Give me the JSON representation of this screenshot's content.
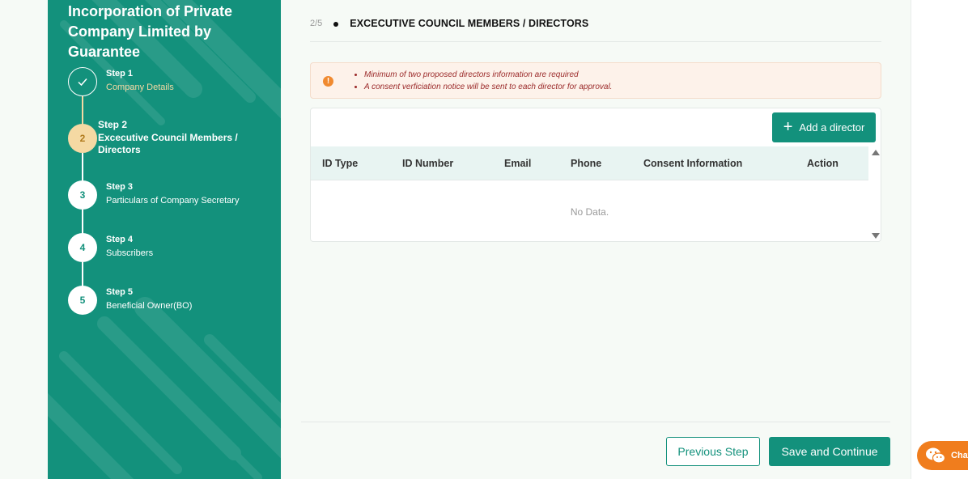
{
  "sidebar": {
    "title": "Incorporation of Private Company Limited by Guarantee",
    "steps": [
      {
        "title": "Step 1",
        "subtitle": "Company Details",
        "number": "",
        "state": "done"
      },
      {
        "title": "Step 2",
        "subtitle": "Excecutive Council Members / Directors",
        "number": "2",
        "state": "active"
      },
      {
        "title": "Step 3",
        "subtitle": "Particulars of Company Secretary",
        "number": "3",
        "state": "pending"
      },
      {
        "title": "Step 4",
        "subtitle": "Subscribers",
        "number": "4",
        "state": "pending"
      },
      {
        "title": "Step 5",
        "subtitle": "Beneficial Owner(BO)",
        "number": "5",
        "state": "pending"
      }
    ]
  },
  "section": {
    "counter": "2/5",
    "title": "EXCECUTIVE COUNCIL MEMBERS / DIRECTORS"
  },
  "alert": {
    "icon": "warning-icon",
    "items": [
      "Minimum of two proposed directors information are required",
      "A consent verficiation notice will be sent to each director for approval."
    ]
  },
  "table": {
    "add_button": "Add a director",
    "columns": [
      "ID Type",
      "ID Number",
      "Email",
      "Phone",
      "Consent Information",
      "Action"
    ],
    "rows": [],
    "empty_text": "No Data."
  },
  "footer": {
    "previous_label": "Previous Step",
    "save_label": "Save and Continue"
  },
  "chat": {
    "label": "Chat"
  },
  "colors": {
    "primary": "#13917c",
    "active_step": "#f5d9a3",
    "alert_bg": "#fdf2ea",
    "alert_text": "#9b2a2a",
    "chat": "#f07d1d"
  }
}
